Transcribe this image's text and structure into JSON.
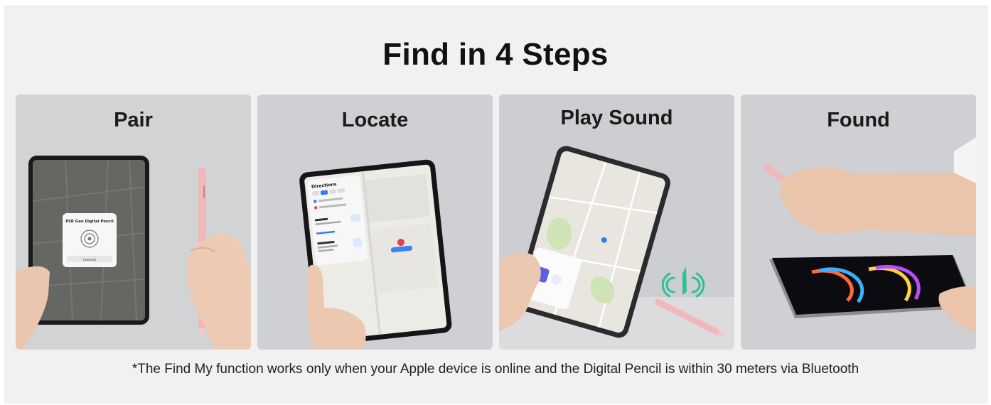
{
  "heading": "Find in 4 Steps",
  "steps": [
    {
      "label": "Pair",
      "screen": {
        "popup_title": "ESR Geo Digital Pencil",
        "popup_button": "Connect"
      }
    },
    {
      "label": "Locate",
      "screen": {
        "sidebar_title": "Directions"
      }
    },
    {
      "label": "Play Sound",
      "screen": {}
    },
    {
      "label": "Found",
      "screen": {}
    }
  ],
  "footnote": "*The Find My function works only when your Apple device is online and the Digital Pencil is within 30 meters via Bluetooth",
  "colors": {
    "background": "#f1f1f1",
    "panel": "#d3d3d5",
    "pencil": "#f0b8bb",
    "sound_waves": "#2fbf9a"
  }
}
